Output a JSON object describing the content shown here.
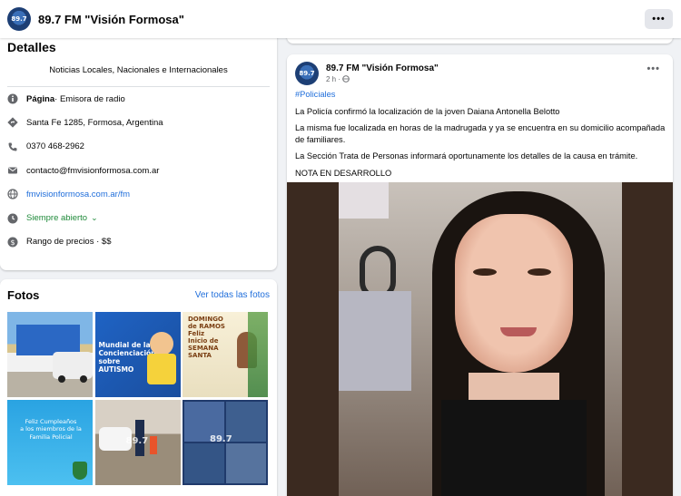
{
  "page": {
    "name": "89.7 FM \"Visión Formosa\"",
    "avatar_text": "89.7",
    "more_label": "•••"
  },
  "details": {
    "heading": "Detalles",
    "description": "Noticias Locales, Nacionales e Internacionales",
    "page_type_label": "Página",
    "page_type_value": " · Emisora de radio",
    "address": "Santa Fe 1285, Formosa, Argentina",
    "phone": "0370 468-2962",
    "email": "contacto@fmvisionformosa.com.ar",
    "website": "fmvisionformosa.com.ar/fm",
    "hours": "Siempre abierto",
    "hours_caret": "⌄",
    "price": "Rango de precios · $$"
  },
  "photos": {
    "heading": "Fotos",
    "see_all": "Ver todas las fotos",
    "tiles": [
      {
        "text": ""
      },
      {
        "text": "Mundial de la\nConcienciación sobre\nAUTISMO"
      },
      {
        "text": "DOMINGO\nde RAMOS\nFeliz\nInicio de\nSEMANA\nSANTA"
      },
      {
        "text": "Feliz Cumpleaños\na los miembros de la\nFamilia Policial"
      },
      {
        "text": "89.7"
      },
      {
        "text": "89.7"
      }
    ]
  },
  "post": {
    "author": "89.7 FM \"Visión Formosa\"",
    "time": "2 h ·",
    "more_label": "•••",
    "hashtag": "#Policiales",
    "paragraphs": [
      "La Policía confirmó la localización de la joven Daiana Antonella Belotto",
      "La misma fue localizada en horas de la madrugada y ya se encuentra en su domicilio acompañada de familiares.",
      "La Sección Trata de Personas informará oportunamente los detalles de la causa en trámite.",
      "NOTA EN DESARROLLO"
    ]
  },
  "colors": {
    "accent": "#216fdb",
    "open_green": "#1f8a3a",
    "background": "#f0f2f5"
  }
}
